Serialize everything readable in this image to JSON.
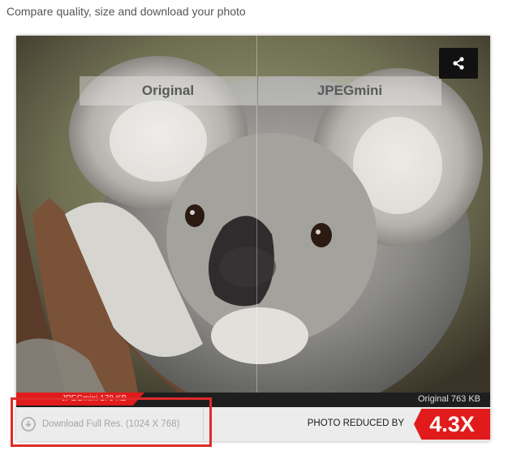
{
  "page": {
    "heading": "Compare quality, size and download your photo"
  },
  "viewer": {
    "label_original": "Original",
    "label_jpegmini": "JPEGmini",
    "share_icon": "share-icon",
    "jpegmini_size": "JPEGmini 178 KB",
    "original_size": "Original 763 KB"
  },
  "bottom": {
    "download_label": "Download Full Res. (1024 X 768)",
    "download_icon": "download-arrow-icon",
    "reduced_label": "PHOTO REDUCED BY",
    "ratio": "4.3X"
  },
  "colors": {
    "accent_red": "#e11b1b",
    "bar_dark": "#1e1e1e",
    "bottom_bg": "#ececec"
  }
}
